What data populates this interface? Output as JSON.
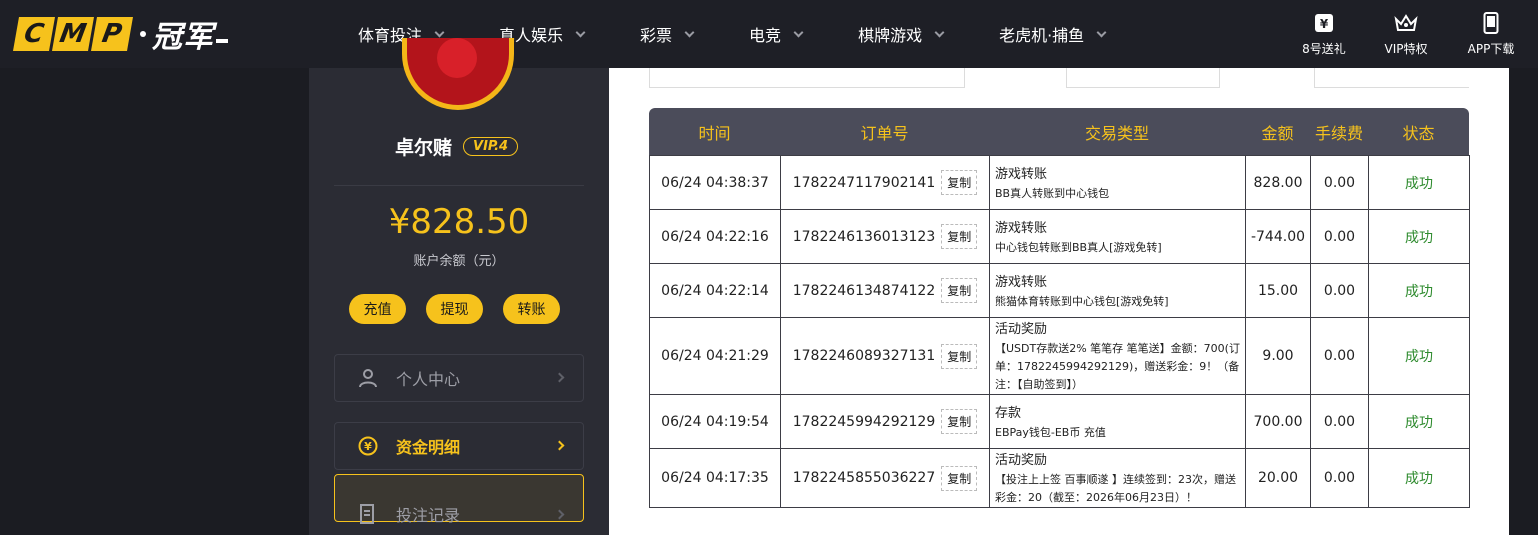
{
  "header": {
    "logo_latin": [
      "C",
      "M",
      "P"
    ],
    "logo_cn": "冠军",
    "nav": [
      {
        "label": "体育投注"
      },
      {
        "label": "真人娱乐"
      },
      {
        "label": "彩票"
      },
      {
        "label": "电竞"
      },
      {
        "label": "棋牌游戏"
      },
      {
        "label": "老虎机·捕鱼"
      }
    ],
    "quick_links": [
      {
        "label": "8号送礼",
        "icon": "gift-ticket-icon"
      },
      {
        "label": "VIP特权",
        "icon": "crown-icon"
      },
      {
        "label": "APP下载",
        "icon": "phone-icon"
      }
    ]
  },
  "sidebar": {
    "username": "卓尔赌",
    "vip": "VIP.4",
    "balance": "¥828.50",
    "balance_label": "账户余额（元）",
    "actions": [
      "充值",
      "提现",
      "转账"
    ],
    "menu": [
      {
        "label": "个人中心",
        "icon": "user-icon"
      },
      {
        "label": "资金明细",
        "icon": "yen-coin-icon"
      },
      {
        "label": "投注记录",
        "icon": "document-icon"
      }
    ]
  },
  "table": {
    "headers": [
      "时间",
      "订单号",
      "交易类型",
      "金额",
      "手续费",
      "状态"
    ],
    "copy_label": "复制",
    "rows": [
      {
        "time": "06/24 04:38:37",
        "order": "1782247117902141",
        "type": "游戏转账",
        "detail": "BB真人转账到中心钱包",
        "amount": "828.00",
        "fee": "0.00",
        "status": "成功"
      },
      {
        "time": "06/24 04:22:16",
        "order": "1782246136013123",
        "type": "游戏转账",
        "detail": "中心钱包转账到BB真人[游戏免转]",
        "amount": "-744.00",
        "fee": "0.00",
        "status": "成功"
      },
      {
        "time": "06/24 04:22:14",
        "order": "1782246134874122",
        "type": "游戏转账",
        "detail": "熊猫体育转账到中心钱包[游戏免转]",
        "amount": "15.00",
        "fee": "0.00",
        "status": "成功"
      },
      {
        "time": "06/24 04:21:29",
        "order": "1782246089327131",
        "type": "活动奖励",
        "detail": "【USDT存款送2% 笔笔存 笔笔送】金额：700(订单：1782245994292129)，赠送彩金：9！（备注：【自助签到】）",
        "amount": "9.00",
        "fee": "0.00",
        "status": "成功"
      },
      {
        "time": "06/24 04:19:54",
        "order": "1782245994292129",
        "type": "存款",
        "detail": "EBPay钱包-EB币 充值",
        "amount": "700.00",
        "fee": "0.00",
        "status": "成功"
      },
      {
        "time": "06/24 04:17:35",
        "order": "1782245855036227",
        "type": "活动奖励",
        "detail": "【投注上上签 百事顺遂 】连续签到：23次，赠送彩金：20（截至：2026年06月23日）！",
        "amount": "20.00",
        "fee": "0.00",
        "status": "成功"
      }
    ]
  }
}
